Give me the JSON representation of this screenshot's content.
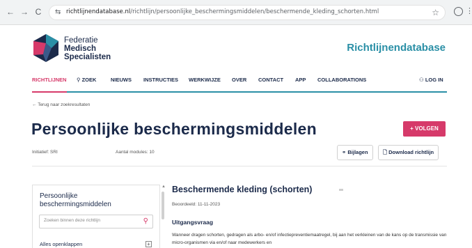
{
  "browser": {
    "back_icon": "arrow-left-icon",
    "forward_icon": "arrow-right-icon",
    "reload_icon": "reload-icon",
    "url_host": "richtlijnendatabase.nl",
    "url_path": "/richtlijn/persoonlijke_beschermingsmiddelen/beschermende_kleding_schorten.html",
    "back": "←",
    "forward": "→",
    "reload": "C",
    "site_info": "⇆",
    "star": "☆",
    "menu": "⋮"
  },
  "header": {
    "brand_line1": "Federatie",
    "brand_line2": "Medisch",
    "brand_line3": "Specialisten",
    "database_title": "Richtlijnendatabase",
    "colors": {
      "navy": "#1b2a4a",
      "teal": "#2a8fa6",
      "pink": "#d63a6a"
    }
  },
  "nav": {
    "items": [
      "RICHTLIJNEN",
      "ZOEK",
      "NIEUWS",
      "INSTRUCTIES",
      "WERKWIJZE",
      "OVER",
      "CONTACT",
      "APP",
      "COLLABORATIONS"
    ],
    "search_label": "ZOEK",
    "login": "LOG IN",
    "active": "RICHTLIJNEN"
  },
  "page": {
    "back_link": "← Terug naar zoekresultaten",
    "title": "Persoonlijke beschermingsmiddelen",
    "follow_button": "+ VOLGEN",
    "initiatief": "Initiatief: SRI",
    "modules": "Aantal modules: 10",
    "bijlagen": "Bijlagen",
    "download": "Download richtlijn"
  },
  "sidebar": {
    "title": "Persoonlijke beschermingsmiddelen",
    "search_placeholder": "Zoeken binnen deze richtlijn",
    "expand_all": "Alles openklappen"
  },
  "content": {
    "section_title": "Beschermende kleding (schorten)",
    "beoordeeld": "Beoordeeld: 11-11-2023",
    "subheading": "Uitgangsvraag",
    "body": "Wanneer dragen schorten, gedragen als arbo- en/of infectiepreventiemaatregel, bij aan het verkleinen van de kans op de transmissie van micro-organismen via en/of naar medewerkers en"
  }
}
